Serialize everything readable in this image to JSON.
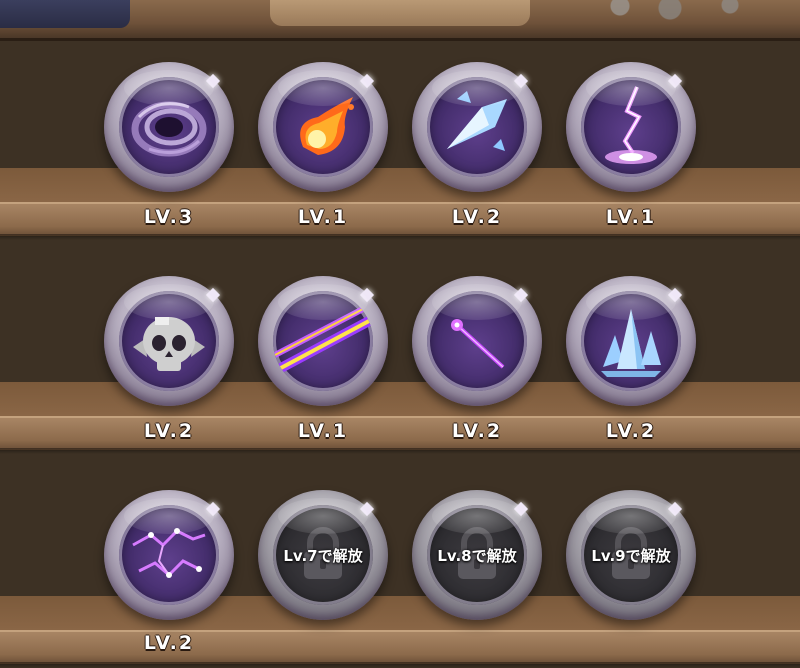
{
  "skills": [
    {
      "id": "vortex",
      "icon": "vortex-icon",
      "level_label": "LV.3"
    },
    {
      "id": "fireball",
      "icon": "fireball-icon",
      "level_label": "LV.1"
    },
    {
      "id": "ice-shard",
      "icon": "ice-shard-icon",
      "level_label": "LV.2"
    },
    {
      "id": "lightning",
      "icon": "lightning-strike-icon",
      "level_label": "LV.1"
    },
    {
      "id": "skull",
      "icon": "skull-icon",
      "level_label": "LV.2"
    },
    {
      "id": "laser-beam",
      "icon": "laser-beam-icon",
      "level_label": "LV.1"
    },
    {
      "id": "magic-wand",
      "icon": "magic-wand-icon",
      "level_label": "LV.2"
    },
    {
      "id": "crystal",
      "icon": "crystal-icon",
      "level_label": "LV.2"
    },
    {
      "id": "chain-lightning",
      "icon": "chain-lightning-icon",
      "level_label": "LV.2"
    },
    {
      "id": "locked-1",
      "icon": "lock-icon",
      "unlock_text": "Lv.7で解放"
    },
    {
      "id": "locked-2",
      "icon": "lock-icon",
      "unlock_text": "Lv.8で解放"
    },
    {
      "id": "locked-3",
      "icon": "lock-icon",
      "unlock_text": "Lv.9で解放"
    }
  ],
  "colors": {
    "background": "#3d3124",
    "shelf": "#8c6a4b",
    "orb_inner": "#3f2a66",
    "locked_inner": "#2b2a2e",
    "label_text": "#ffffff"
  }
}
